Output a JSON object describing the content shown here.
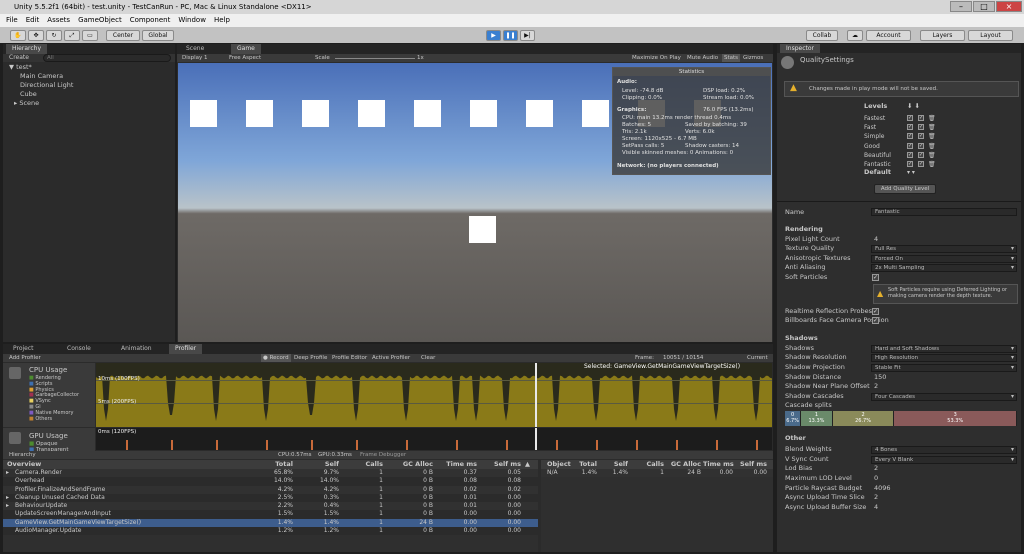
{
  "window": {
    "title": "Unity 5.5.2f1 (64bit) - test.unity - TestCanRun - PC, Mac & Linux Standalone <DX11>"
  },
  "menu": [
    "File",
    "Edit",
    "Assets",
    "GameObject",
    "Component",
    "Window",
    "Help"
  ],
  "toolbar": {
    "pivot": "Center",
    "space": "Global",
    "collab": "Collab",
    "account": "Account",
    "layers": "Layers",
    "layout": "Layout"
  },
  "hierarchy": {
    "tab": "Hierarchy",
    "create": "Create",
    "search_placeholder": "All",
    "scene": "test*",
    "items": [
      "Main Camera",
      "Directional Light",
      "Cube",
      "Scene"
    ]
  },
  "game": {
    "scene_tab": "Scene",
    "game_tab": "Game",
    "display": "Display 1",
    "aspect": "Free Aspect",
    "scale_label": "Scale",
    "scale_value": "1x",
    "maximize": "Maximize On Play",
    "mute": "Mute Audio",
    "stats": "Stats",
    "gizmos": "Gizmos"
  },
  "stats": {
    "title": "Statistics",
    "audio": "Audio:",
    "level": "Level: -74.8 dB",
    "dsp": "DSP load: 0.2%",
    "clipping": "Clipping: 0.0%",
    "stream": "Stream load: 0.0%",
    "graphics": "Graphics:",
    "fps": "76.0 FPS (13.2ms)",
    "cpu": "CPU: main 13.2ms  render thread 0.4ms",
    "batches": "Batches: 5",
    "saved": "Saved by batching: 39",
    "tris": "Tris: 2.1k",
    "verts": "Verts: 6.0k",
    "screen": "Screen: 1120x525 - 6.7 MB",
    "setpass": "SetPass calls: 5",
    "shadow": "Shadow casters: 14",
    "skinned": "Visible skinned meshes: 0  Animations: 0",
    "network": "Network: (no players connected)"
  },
  "bottom_tabs": [
    "Project",
    "Console",
    "Animation",
    "Profiler"
  ],
  "profiler": {
    "add": "Add Profiler",
    "record": "Record",
    "deep": "Deep Profile",
    "editor": "Profile Editor",
    "active": "Active Profiler",
    "clear": "Clear",
    "frame_label": "Frame:",
    "frame_value": "10051 / 10154",
    "current": "Current",
    "cpu": {
      "label": "CPU Usage",
      "items": [
        "Rendering",
        "Scripts",
        "Physics",
        "GarbageCollector",
        "VSync",
        "Gi",
        "Native Memory",
        "Others"
      ],
      "colors": [
        "#4d8c2f",
        "#3d6fb0",
        "#e0a030",
        "#a03050",
        "#e8d060",
        "#888888",
        "#7e5ac2",
        "#c08030"
      ],
      "tick1": "10ms (100FPS)",
      "tick2": "5ms (200FPS)",
      "selected": "Selected: GameView.GetMainGameViewTargetSize()"
    },
    "gpu": {
      "label": "GPU Usage",
      "items": [
        "Opaque",
        "Transparent"
      ],
      "tick": "0ms (120FPS)"
    },
    "summary": {
      "mode": "Hierarchy",
      "cpu": "CPU:0.57ms",
      "gpu": "GPU:0.33ms",
      "debugger": "Frame Debugger"
    },
    "columns": [
      "Overview",
      "Total",
      "Self",
      "Calls",
      "GC Alloc",
      "Time ms",
      "Self ms"
    ],
    "rows": [
      {
        "name": "Camera.Render",
        "total": "65.8%",
        "self": "9.7%",
        "calls": "1",
        "gc": "0 B",
        "time": "0.37",
        "selfms": "0.05",
        "arrow": true
      },
      {
        "name": "Overhead",
        "total": "14.0%",
        "self": "14.0%",
        "calls": "1",
        "gc": "0 B",
        "time": "0.08",
        "selfms": "0.08",
        "arrow": false
      },
      {
        "name": "Profiler.FinalizeAndSendFrame",
        "total": "4.2%",
        "self": "4.2%",
        "calls": "1",
        "gc": "0 B",
        "time": "0.02",
        "selfms": "0.02",
        "arrow": false
      },
      {
        "name": "Cleanup Unused Cached Data",
        "total": "2.5%",
        "self": "0.3%",
        "calls": "1",
        "gc": "0 B",
        "time": "0.01",
        "selfms": "0.00",
        "arrow": true
      },
      {
        "name": "BehaviourUpdate",
        "total": "2.2%",
        "self": "0.4%",
        "calls": "1",
        "gc": "0 B",
        "time": "0.01",
        "selfms": "0.00",
        "arrow": true
      },
      {
        "name": "UpdateScreenManagerAndInput",
        "total": "1.5%",
        "self": "1.5%",
        "calls": "1",
        "gc": "0 B",
        "time": "0.00",
        "selfms": "0.00",
        "arrow": false
      },
      {
        "name": "GameView.GetMainGameViewTargetSize()",
        "total": "1.4%",
        "self": "1.4%",
        "calls": "1",
        "gc": "24 B",
        "time": "0.00",
        "selfms": "0.00",
        "arrow": false
      },
      {
        "name": "AudioManager.Update",
        "total": "1.2%",
        "self": "1.2%",
        "calls": "1",
        "gc": "0 B",
        "time": "0.00",
        "selfms": "0.00",
        "arrow": false
      }
    ],
    "selected_row": 6,
    "detail_columns": [
      "Object",
      "Total",
      "Self",
      "Calls",
      "GC Alloc",
      "Time ms",
      "Self ms"
    ],
    "detail_row": {
      "obj": "N/A",
      "total": "1.4%",
      "self": "1.4%",
      "calls": "1",
      "gc": "24 B",
      "time": "0.00",
      "selfms": "0.00"
    }
  },
  "inspector": {
    "tab": "Inspector",
    "title": "QualitySettings",
    "warning": "Changes made in play mode will not be saved.",
    "levels_header": "Levels",
    "levels": [
      "Fastest",
      "Fast",
      "Simple",
      "Good",
      "Beautiful",
      "Fantastic"
    ],
    "default": "Default",
    "add_level": "Add Quality Level",
    "name_label": "Name",
    "name_value": "Fantastic",
    "rendering": "Rendering",
    "pixel_light_label": "Pixel Light Count",
    "pixel_light": "4",
    "texture_label": "Texture Quality",
    "texture": "Full Res",
    "aniso_label": "Anisotropic Textures",
    "aniso": "Forced On",
    "aa_label": "Anti Aliasing",
    "aa": "2x Multi Sampling",
    "soft_label": "Soft Particles",
    "soft_warning": "Soft Particles require using Deferred Lighting or making camera render the depth texture.",
    "rtp_label": "Realtime Reflection Probes",
    "billboard_label": "Billboards Face Camera Position",
    "shadows_h": "Shadows",
    "shadows_label": "Shadows",
    "shadows": "Hard and Soft Shadows",
    "shres_label": "Shadow Resolution",
    "shres": "High Resolution",
    "shproj_label": "Shadow Projection",
    "shproj": "Stable Fit",
    "shdist_label": "Shadow Distance",
    "shdist": "150",
    "shnear_label": "Shadow Near Plane Offset",
    "shnear": "2",
    "shcasc_label": "Shadow Cascades",
    "shcasc": "Four Cascades",
    "splits_label": "Cascade splits",
    "splits": [
      {
        "idx": "0",
        "pct": "6.7%",
        "frac": 0.067,
        "color": "#4a6a8a"
      },
      {
        "idx": "1",
        "pct": "13.3%",
        "frac": 0.133,
        "color": "#6a8a6a"
      },
      {
        "idx": "2",
        "pct": "26.7%",
        "frac": 0.267,
        "color": "#8a8a5a"
      },
      {
        "idx": "3",
        "pct": "53.3%",
        "frac": 0.533,
        "color": "#8a5a5a"
      }
    ],
    "other_h": "Other",
    "blend_label": "Blend Weights",
    "blend": "4 Bones",
    "vsync_label": "V Sync Count",
    "vsync": "Every V Blank",
    "lod_label": "Lod Bias",
    "lod": "2",
    "maxlod_label": "Maximum LOD Level",
    "maxlod": "0",
    "raycast_label": "Particle Raycast Budget",
    "raycast": "4096",
    "asyncslice_label": "Async Upload Time Slice",
    "asyncslice": "2",
    "asyncbuf_label": "Async Upload Buffer Size",
    "asyncbuf": "4"
  }
}
